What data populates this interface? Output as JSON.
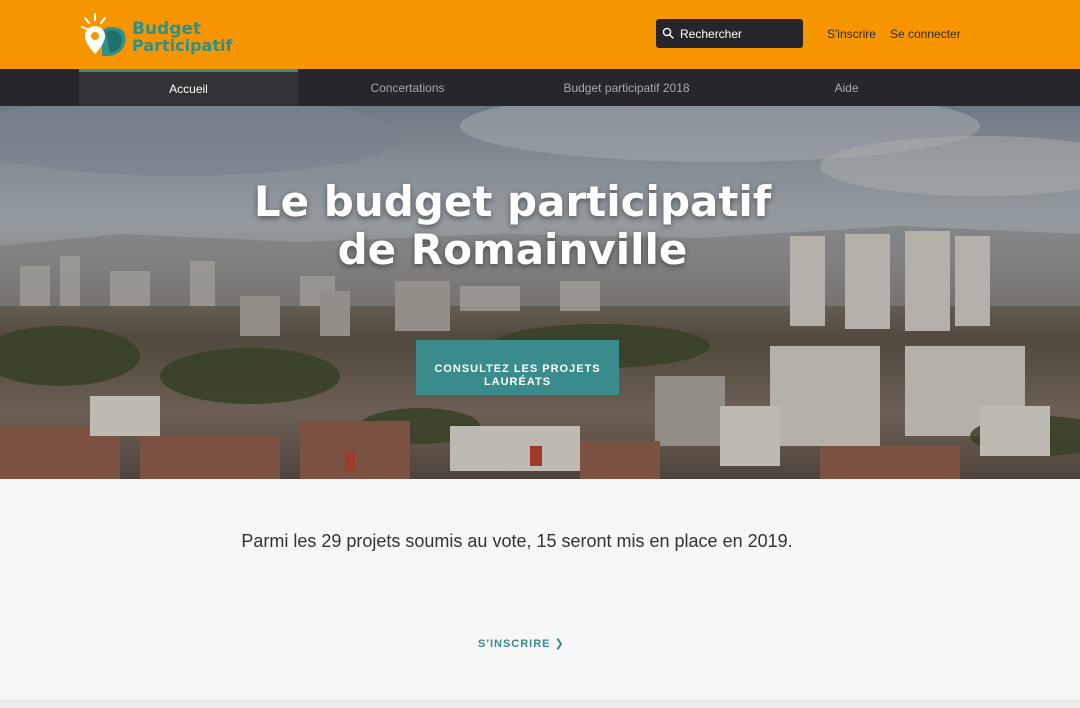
{
  "header": {
    "logo": {
      "line1": "Budget",
      "line2": "Participatif"
    },
    "search": {
      "placeholder": "Rechercher"
    },
    "signup_label": "S'inscrire",
    "login_label": "Se connecter"
  },
  "nav": {
    "tabs": [
      {
        "label": "Accueil",
        "active": true
      },
      {
        "label": "Concertations",
        "active": false
      },
      {
        "label": "Budget participatif 2018",
        "active": false
      },
      {
        "label": "Aide",
        "active": false
      }
    ]
  },
  "hero": {
    "title_line1": "Le budget participatif",
    "title_line2": "de Romainville",
    "cta_line1": "CONSULTEZ LES PROJETS",
    "cta_line2": "LAURÉATS"
  },
  "main": {
    "intro": "Parmi les 29 projets soumis au vote, 15 seront mis en place en 2019.",
    "signup_cta": "S'INSCRIRE"
  },
  "colors": {
    "header_bg": "#f79500",
    "nav_bg": "#27262b",
    "accent": "#3a8b8c"
  }
}
